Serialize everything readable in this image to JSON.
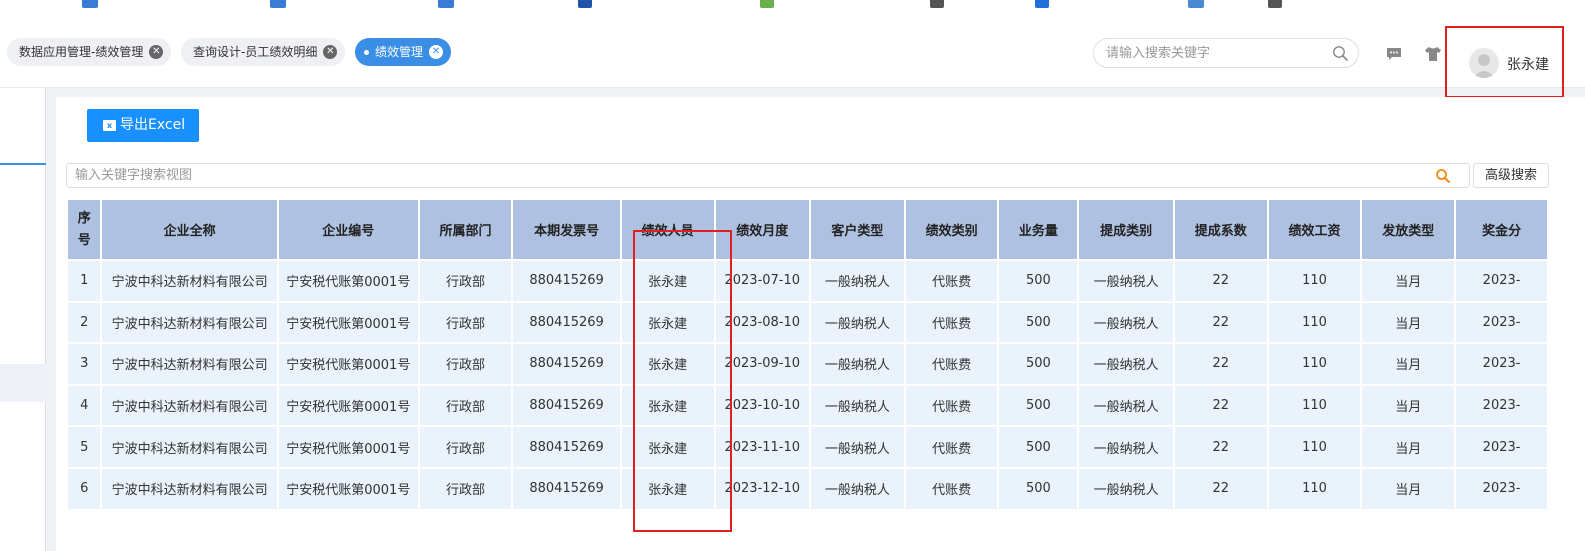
{
  "tabs": [
    {
      "label": "数据应用管理-绩效管理",
      "active": false
    },
    {
      "label": "查询设计-员工绩效明细",
      "active": false
    },
    {
      "label": "绩效管理",
      "active": true
    }
  ],
  "header": {
    "search_placeholder": "请输入搜索关键字",
    "user_name": "张永建",
    "icons": [
      "chat-icon",
      "shirt-icon",
      "search-icon",
      "avatar"
    ]
  },
  "toolbar": {
    "export_label": "导出Excel",
    "view_search_placeholder": "输入关键字搜索视图",
    "advanced_search_label": "高级搜索"
  },
  "colors": {
    "accent": "#1890ff",
    "active_tab": "#3a8ee6",
    "header_cell": "#aec1e0",
    "body_cell": "#eaf2fb",
    "highlight": "#e02020"
  },
  "table": {
    "columns": [
      "序号",
      "企业全称",
      "企业编号",
      "所属部门",
      "本期发票号",
      "绩效人员",
      "绩效月度",
      "客户类型",
      "绩效类别",
      "业务量",
      "提成类别",
      "提成系数",
      "绩效工资",
      "发放类型",
      "奖金分"
    ],
    "rows": [
      [
        "1",
        "宁波中科达新材料有限公司",
        "宁安税代账第0001号",
        "行政部",
        "880415269",
        "张永建",
        "2023-07-10",
        "一般纳税人",
        "代账费",
        "500",
        "一般纳税人",
        "22",
        "110",
        "当月",
        "2023-"
      ],
      [
        "2",
        "宁波中科达新材料有限公司",
        "宁安税代账第0001号",
        "行政部",
        "880415269",
        "张永建",
        "2023-08-10",
        "一般纳税人",
        "代账费",
        "500",
        "一般纳税人",
        "22",
        "110",
        "当月",
        "2023-"
      ],
      [
        "3",
        "宁波中科达新材料有限公司",
        "宁安税代账第0001号",
        "行政部",
        "880415269",
        "张永建",
        "2023-09-10",
        "一般纳税人",
        "代账费",
        "500",
        "一般纳税人",
        "22",
        "110",
        "当月",
        "2023-"
      ],
      [
        "4",
        "宁波中科达新材料有限公司",
        "宁安税代账第0001号",
        "行政部",
        "880415269",
        "张永建",
        "2023-10-10",
        "一般纳税人",
        "代账费",
        "500",
        "一般纳税人",
        "22",
        "110",
        "当月",
        "2023-"
      ],
      [
        "5",
        "宁波中科达新材料有限公司",
        "宁安税代账第0001号",
        "行政部",
        "880415269",
        "张永建",
        "2023-11-10",
        "一般纳税人",
        "代账费",
        "500",
        "一般纳税人",
        "22",
        "110",
        "当月",
        "2023-"
      ],
      [
        "6",
        "宁波中科达新材料有限公司",
        "宁安税代账第0001号",
        "行政部",
        "880415269",
        "张永建",
        "2023-12-10",
        "一般纳税人",
        "代账费",
        "500",
        "一般纳税人",
        "22",
        "110",
        "当月",
        "2023-"
      ]
    ]
  }
}
